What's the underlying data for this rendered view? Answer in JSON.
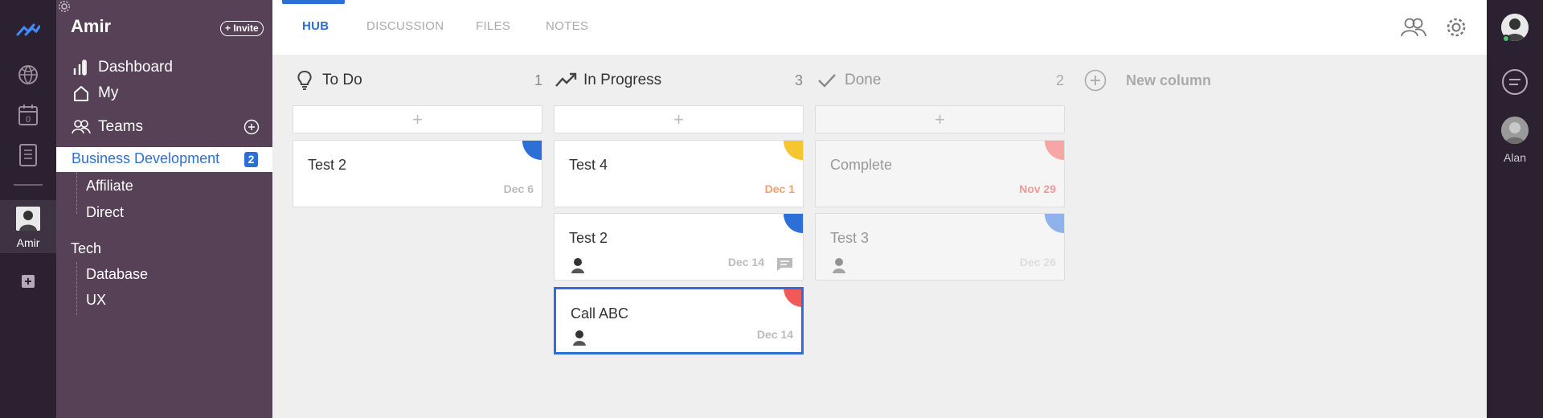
{
  "rail": {
    "icons": [
      "logo-icon",
      "globe-icon",
      "calendar-icon",
      "document-icon"
    ],
    "calendar_count": "0",
    "user_name": "Amir"
  },
  "sidebar": {
    "user": "Amir",
    "invite_label": "+ Invite",
    "nav": [
      {
        "label": "Dashboard",
        "icon": "bar-chart-icon"
      },
      {
        "label": "My",
        "icon": "home-icon"
      },
      {
        "label": "Teams",
        "icon": "teams-icon"
      }
    ],
    "selected": {
      "label": "Business Development",
      "badge": "2"
    },
    "selected_children": [
      "Affiliate",
      "Direct"
    ],
    "group": {
      "label": "Tech",
      "children": [
        "Database",
        "UX"
      ]
    }
  },
  "topbar": {
    "tabs": [
      "HUB",
      "DISCUSSION",
      "FILES",
      "NOTES"
    ],
    "active_tab": "HUB"
  },
  "right_rail": {
    "member_name": "Alan"
  },
  "board": {
    "columns": [
      {
        "title": "To Do",
        "count": "1",
        "icon": "lightbulb-icon",
        "cards": [
          {
            "title": "Test 2",
            "date": "Dec 6",
            "corner": "#2c6fd6",
            "date_color": "#bbbbbb"
          }
        ]
      },
      {
        "title": "In Progress",
        "count": "3",
        "icon": "trend-icon",
        "cards": [
          {
            "title": "Test 4",
            "date": "Dec 1",
            "corner": "#f7c52f",
            "date_color": "#f0a070"
          },
          {
            "title": "Test 2",
            "date": "Dec 14",
            "corner": "#2c6fd6",
            "date_color": "#bbbbbb",
            "assignee": true,
            "comments": true
          },
          {
            "title": "Call ABC",
            "date": "Dec 14",
            "corner": "#f25a5a",
            "date_color": "#bbbbbb",
            "assignee": true,
            "selected": true
          }
        ]
      },
      {
        "title": "Done",
        "count": "2",
        "icon": "check-icon",
        "cards": [
          {
            "title": "Complete",
            "date": "Nov 29",
            "corner": "#f8a5a5",
            "date_color": "#f09a9a"
          },
          {
            "title": "Test 3",
            "date": "Dec 26",
            "corner": "#8fb1ec",
            "date_color": "#dddddd",
            "assignee": true
          }
        ]
      }
    ],
    "add_card_symbol": "+",
    "new_column_label": "New column"
  }
}
